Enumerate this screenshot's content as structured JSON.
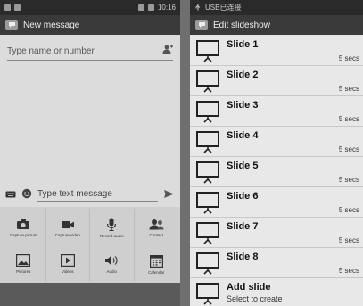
{
  "left_screen": {
    "statusbar": {
      "time": "10:16"
    },
    "actionbar": {
      "title": "New message"
    },
    "recipient": {
      "placeholder": "Type name or number"
    },
    "message": {
      "placeholder": "Type text message"
    },
    "attachments": [
      {
        "label": "Capture picture",
        "icon": "camera-icon"
      },
      {
        "label": "Capture video",
        "icon": "video-camera-icon"
      },
      {
        "label": "Record audio",
        "icon": "microphone-icon"
      },
      {
        "label": "Contact",
        "icon": "contact-icon"
      },
      {
        "label": "Pictures",
        "icon": "picture-icon"
      },
      {
        "label": "Videos",
        "icon": "play-icon"
      },
      {
        "label": "Audio",
        "icon": "speaker-icon"
      },
      {
        "label": "Calendar",
        "icon": "calendar-icon"
      }
    ]
  },
  "right_screen": {
    "statusbar": {
      "notification": "USB已连接"
    },
    "actionbar": {
      "title": "Edit slideshow"
    },
    "slides": [
      {
        "title": "Slide 1",
        "duration": "5 secs"
      },
      {
        "title": "Slide 2",
        "duration": "5 secs"
      },
      {
        "title": "Slide 3",
        "duration": "5 secs"
      },
      {
        "title": "Slide 4",
        "duration": "5 secs"
      },
      {
        "title": "Slide 5",
        "duration": "5 secs"
      },
      {
        "title": "Slide 6",
        "duration": "5 secs"
      },
      {
        "title": "Slide 7",
        "duration": "5 secs"
      },
      {
        "title": "Slide 8",
        "duration": "5 secs"
      }
    ],
    "add_slide": {
      "title": "Add slide",
      "subtitle": "Select to create"
    }
  }
}
